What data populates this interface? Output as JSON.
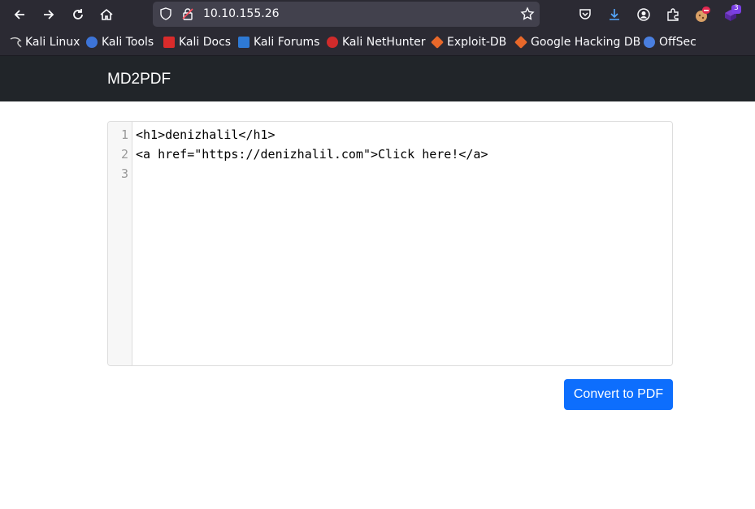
{
  "browser": {
    "url": "10.10.155.26",
    "extension_badge": "3",
    "bookmarks": [
      {
        "label": "Kali Linux",
        "icon": "kali-dragon-icon",
        "color": "#c8c8c8"
      },
      {
        "label": "Kali Tools",
        "icon": "kali-tools-icon",
        "color": "#3d74d8"
      },
      {
        "label": "Kali Docs",
        "icon": "kali-docs-icon",
        "color": "#d92b2b"
      },
      {
        "label": "Kali Forums",
        "icon": "kali-forums-icon",
        "color": "#2e79d4"
      },
      {
        "label": "Kali NetHunter",
        "icon": "nethunter-icon",
        "color": "#d02b2b"
      },
      {
        "label": "Exploit-DB",
        "icon": "exploit-db-icon",
        "color": "#e8682a"
      },
      {
        "label": "Google Hacking DB",
        "icon": "ghdb-icon",
        "color": "#e8682a"
      },
      {
        "label": "OffSec",
        "icon": "offsec-icon",
        "color": "#4a7fe0"
      }
    ]
  },
  "page": {
    "brand": "MD2PDF",
    "editor": {
      "line_numbers": [
        "1",
        "2",
        "3"
      ],
      "lines": [
        "<h1>denizhalil</h1>",
        "<a href=\"https://denizhalil.com\">Click here!</a>",
        ""
      ]
    },
    "convert_button": "Convert to PDF"
  },
  "colors": {
    "navbar": "#212529",
    "primary_button": "#0d6efd"
  }
}
